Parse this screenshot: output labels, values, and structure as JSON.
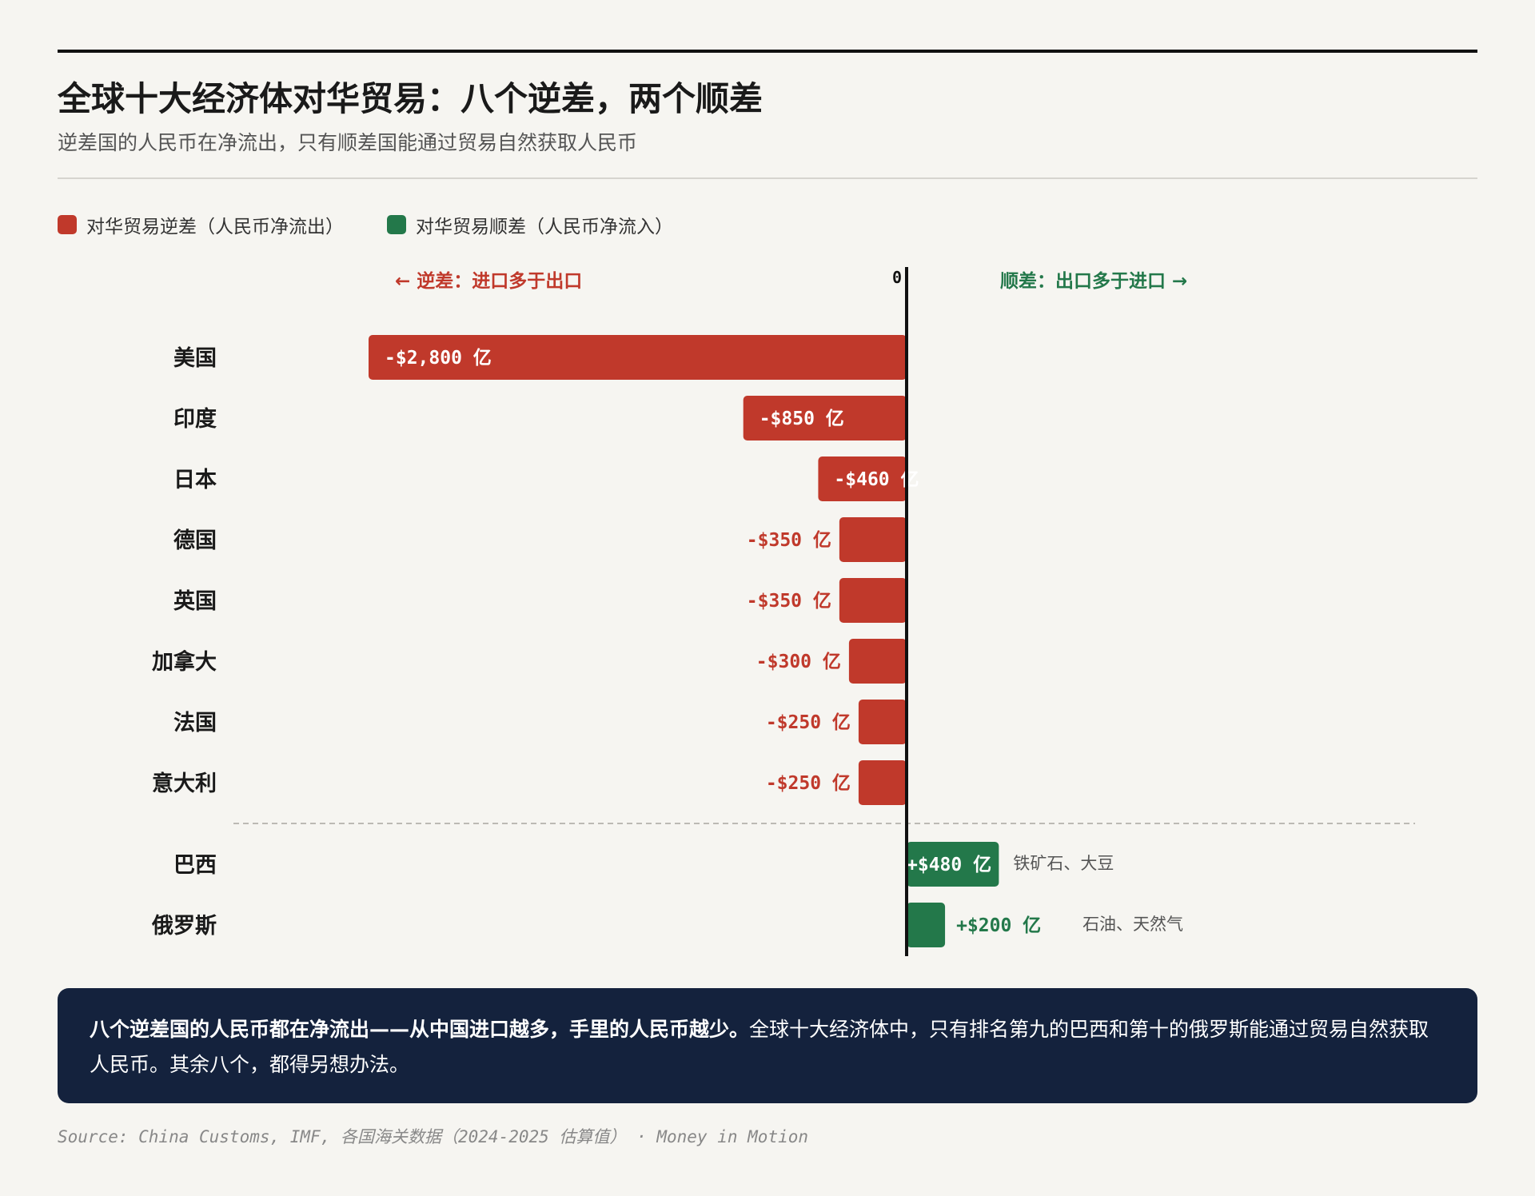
{
  "header": {
    "title": "全球十大经济体对华贸易：八个逆差，两个顺差",
    "subtitle": "逆差国的人民币在净流出，只有顺差国能通过贸易自然获取人民币"
  },
  "legend": {
    "deficit_label": "对华贸易逆差（人民币净流出）",
    "surplus_label": "对华贸易顺差（人民币净流入）"
  },
  "colors": {
    "deficit": "#c0392b",
    "surplus": "#23784a",
    "text": "#1a1a1a",
    "callout_bg": "#14223d"
  },
  "chart_data": {
    "type": "bar",
    "orientation": "horizontal",
    "unit": "亿",
    "zero_label": "0",
    "left_direction_label": "← 逆差：进口多于出口",
    "right_direction_label": "顺差：出口多于进口 →",
    "categories": [
      "美国",
      "印度",
      "日本",
      "德国",
      "英国",
      "加拿大",
      "法国",
      "意大利",
      "巴西",
      "俄罗斯"
    ],
    "values": [
      -2800,
      -850,
      -460,
      -350,
      -350,
      -300,
      -250,
      -250,
      480,
      200
    ],
    "value_labels": [
      "-$2,800 亿",
      "-$850 亿",
      "-$460 亿",
      "-$350 亿",
      "-$350 亿",
      "-$300 亿",
      "-$250 亿",
      "-$250 亿",
      "+$480 亿",
      "+$200 亿"
    ],
    "notes": [
      "",
      "",
      "",
      "",
      "",
      "",
      "",
      "",
      "铁矿石、大豆",
      "石油、天然气"
    ],
    "xlim": [
      -2800,
      480
    ]
  },
  "callout": {
    "bold_text": "八个逆差国的人民币都在净流出——从中国进口越多，手里的人民币越少。",
    "text": "全球十大经济体中，只有排名第九的巴西和第十的俄罗斯能通过贸易自然获取人民币。其余八个，都得另想办法。"
  },
  "source": "Source: China Customs, IMF, 各国海关数据（2024-2025 估算值） · Money in Motion"
}
